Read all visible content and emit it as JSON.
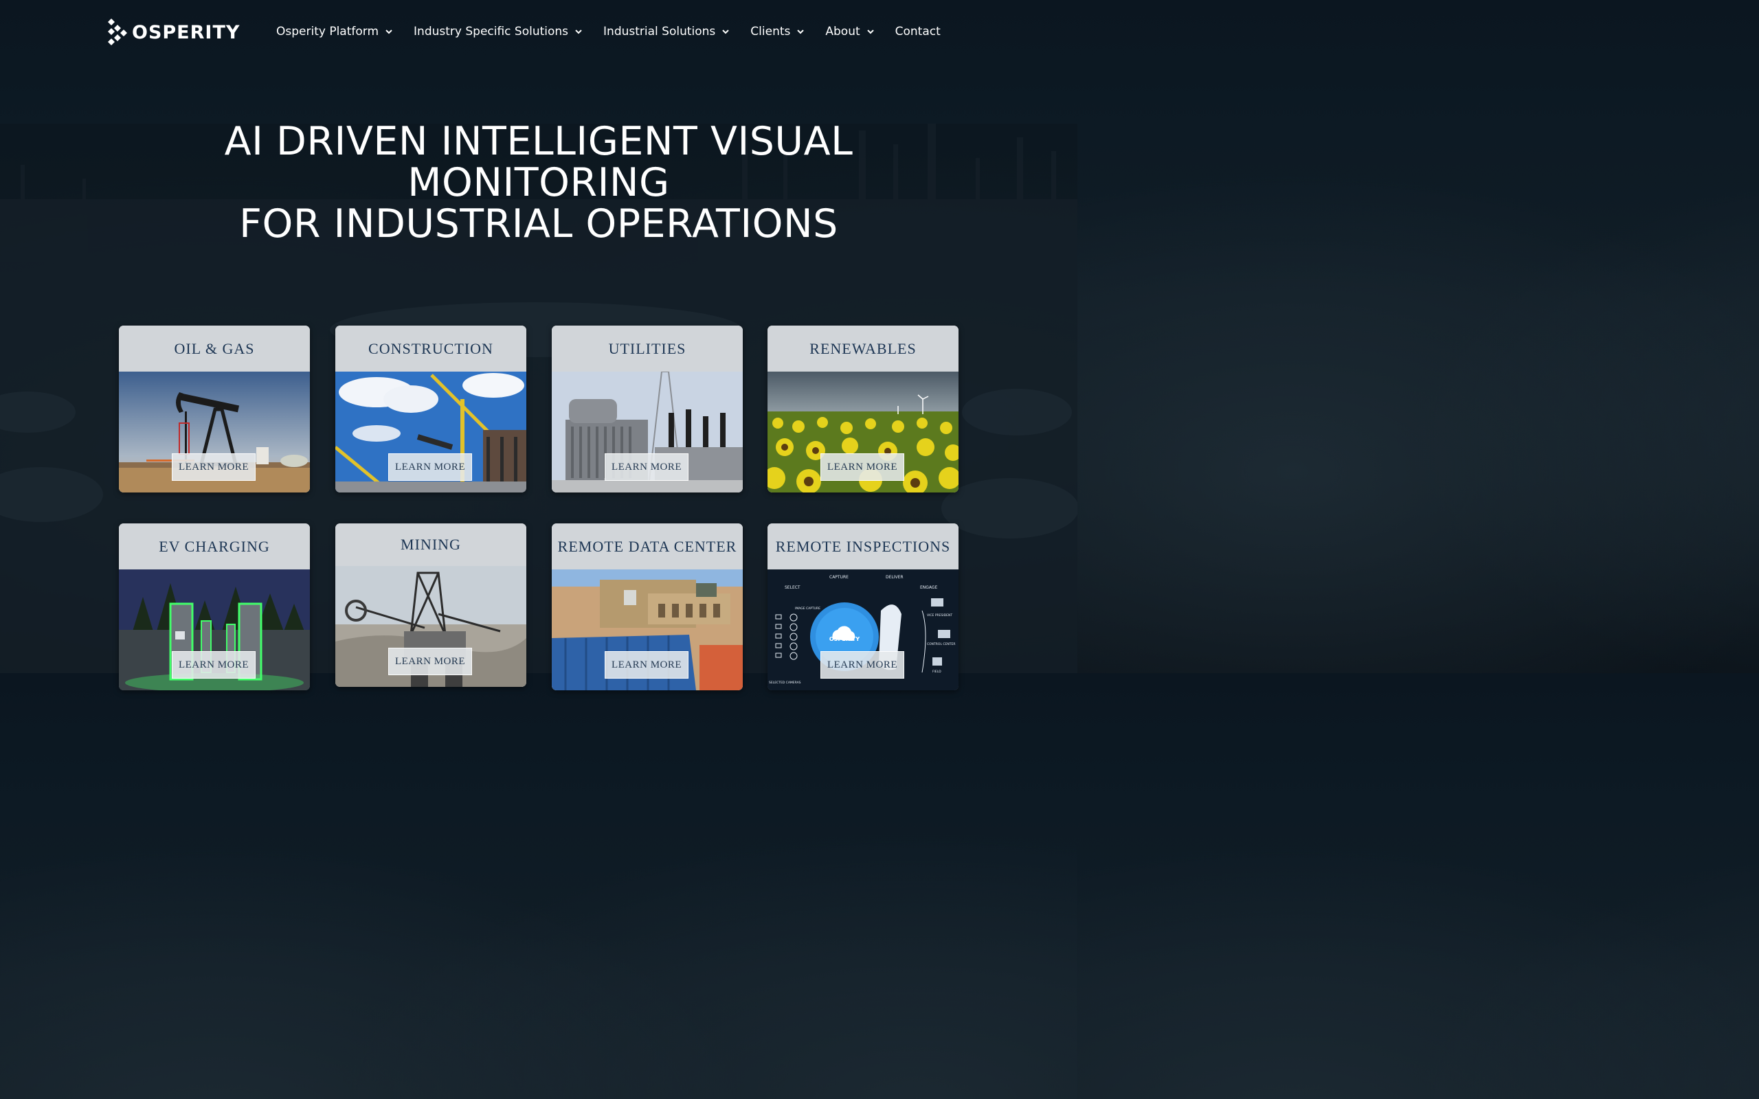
{
  "brand": {
    "name": "OSPERITY"
  },
  "nav": {
    "items": [
      {
        "label": "Osperity Platform",
        "has_dropdown": true
      },
      {
        "label": "Industry Specific Solutions",
        "has_dropdown": true
      },
      {
        "label": "Industrial Solutions",
        "has_dropdown": true
      },
      {
        "label": "Clients",
        "has_dropdown": true
      },
      {
        "label": "About",
        "has_dropdown": true
      },
      {
        "label": "Contact",
        "has_dropdown": false
      }
    ]
  },
  "hero": {
    "lines": [
      "AI DRIVEN INTELLIGENT VISUAL",
      "MONITORING",
      "FOR INDUSTRIAL OPERATIONS"
    ]
  },
  "cards": [
    {
      "title": "OIL & GAS",
      "button": "LEARN MORE",
      "image": "pumpjack"
    },
    {
      "title": "CONSTRUCTION",
      "button": "LEARN MORE",
      "image": "cranes"
    },
    {
      "title": "UTILITIES",
      "button": "LEARN MORE",
      "image": "substation"
    },
    {
      "title": "RENEWABLES",
      "button": "LEARN MORE",
      "image": "sunflowers"
    },
    {
      "title": "EV CHARGING",
      "button": "LEARN MORE",
      "image": "ev-chargers"
    },
    {
      "title": "MINING",
      "button": "LEARN MORE",
      "image": "excavator"
    },
    {
      "title": "REMOTE DATA CENTER",
      "button": "LEARN MORE",
      "image": "data-center"
    },
    {
      "title": "REMOTE INSPECTIONS",
      "button": "LEARN MORE",
      "image": "inspection-diagram"
    }
  ],
  "inspection_diagram": {
    "labels": [
      "SELECT",
      "CAPTURE",
      "DELIVER",
      "ENGAGE",
      "IMAGE CAPTURE",
      "SELECTED CAMERAS",
      "VICE PRESIDENT",
      "CONTROL CENTER",
      "FIELD"
    ],
    "center_logo": "OSPERITY"
  },
  "colors": {
    "background": "#0d1a24",
    "card_title_bg": "#d1d5d9",
    "card_title_text": "#1c3553",
    "button_text": "#253a52"
  }
}
